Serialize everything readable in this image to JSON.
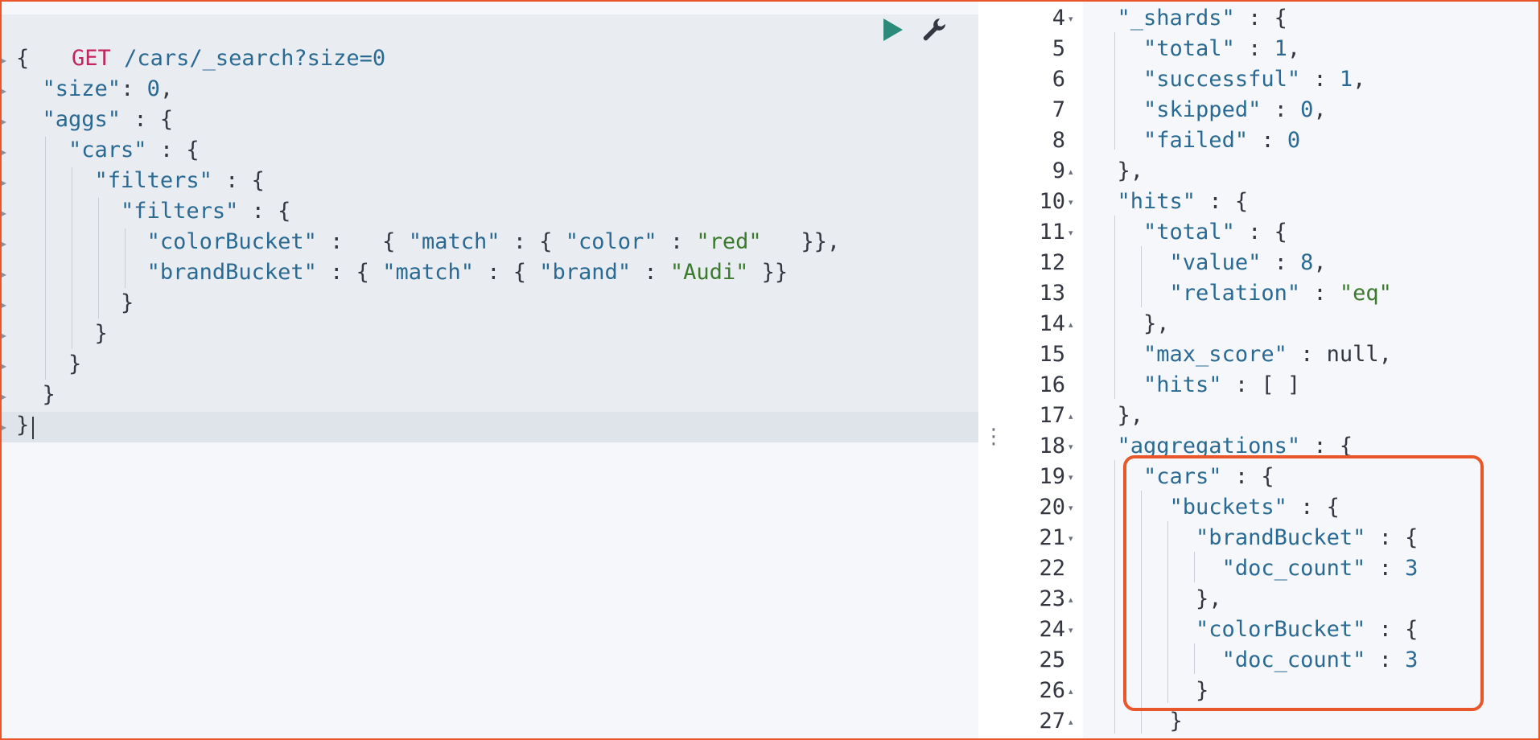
{
  "request": {
    "method": "GET",
    "path": "/cars/_search?size=0",
    "lines": [
      "{",
      "  \"size\": 0,",
      "  \"aggs\" : {",
      "    \"cars\" : {",
      "      \"filters\" : {",
      "        \"filters\" : {",
      "          \"colorBucket\" :   { \"match\" : { \"color\" : \"red\"   }},",
      "          \"brandBucket\" : { \"match\" : { \"brand\" : \"Audi\" }}",
      "        }",
      "      }",
      "    }",
      "  }",
      "}"
    ],
    "run_icon": "play-icon",
    "settings_icon": "wrench-icon"
  },
  "resizer_icon": "vertical-ellipsis-icon",
  "response": {
    "line_numbers": [
      "4",
      "5",
      "6",
      "7",
      "8",
      "9",
      "10",
      "11",
      "12",
      "13",
      "14",
      "15",
      "16",
      "17",
      "18",
      "19",
      "20",
      "21",
      "22",
      "23",
      "24",
      "25",
      "26",
      "27"
    ],
    "lines": [
      "  \"_shards\" : {",
      "    \"total\" : 1,",
      "    \"successful\" : 1,",
      "    \"skipped\" : 0,",
      "    \"failed\" : 0",
      "  },",
      "  \"hits\" : {",
      "    \"total\" : {",
      "      \"value\" : 8,",
      "      \"relation\" : \"eq\"",
      "    },",
      "    \"max_score\" : null,",
      "    \"hits\" : [ ]",
      "  },",
      "  \"aggregations\" : {",
      "    \"cars\" : {",
      "      \"buckets\" : {",
      "        \"brandBucket\" : {",
      "          \"doc_count\" : 3",
      "        },",
      "        \"colorBucket\" : {",
      "          \"doc_count\" : 3",
      "        }",
      "      }"
    ]
  },
  "colors": {
    "highlight": "#e8562a",
    "run_button": "#2c8a7a",
    "key": "#2a6a92",
    "string": "#3b7a2d",
    "method": "#c2255c"
  }
}
